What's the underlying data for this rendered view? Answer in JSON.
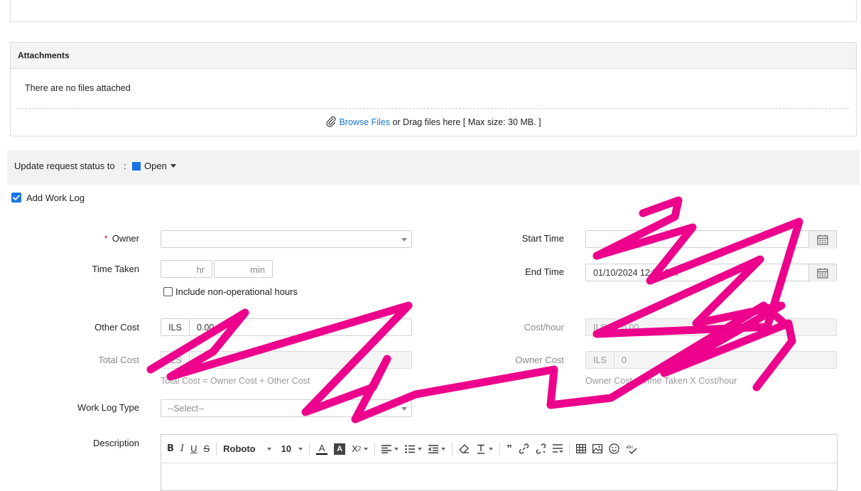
{
  "attachments": {
    "title": "Attachments",
    "empty_text": "There are no files attached",
    "browse_link": "Browse Files",
    "drag_text": " or Drag files here [ Max size: 30 MB. ]"
  },
  "status": {
    "label": "Update request status to",
    "separator": ":",
    "value": "Open",
    "color": "#1a73e8"
  },
  "worklog": {
    "checkbox_label": "Add Work Log",
    "checked": true,
    "owner_label": "Owner",
    "required_mark": "*",
    "time_taken_label": "Time Taken",
    "hr_unit": "hr",
    "min_unit": "min",
    "non_operational_label": "Include non-operational hours",
    "start_time_label": "Start Time",
    "end_time_label": "End Time",
    "end_time_value": "01/10/2024 12:54 PM",
    "other_cost_label": "Other Cost",
    "other_cost_currency": "ILS",
    "other_cost_value": "0.00",
    "cost_hour_label": "Cost/hour",
    "cost_hour_currency": "ILS",
    "cost_hour_value": "0.00",
    "total_cost_label": "Total Cost",
    "total_cost_currency": "ILS",
    "total_cost_value": "0",
    "owner_cost_label": "Owner Cost",
    "owner_cost_currency": "ILS",
    "owner_cost_value": "0",
    "total_cost_hint": "Total Cost = Owner Cost + Other Cost",
    "owner_cost_hint": "Owner Cost = Time Taken X Cost/hour",
    "worklog_type_label": "Work Log Type",
    "worklog_type_placeholder": "--Select--",
    "description_label": "Description"
  },
  "editor": {
    "font_name": "Roboto",
    "font_size": "10",
    "tools": [
      "bold",
      "italic",
      "underline",
      "strikethrough",
      "font-family",
      "font-size",
      "font-color",
      "highlight",
      "superscript",
      "align",
      "list",
      "indent",
      "clear-format",
      "text-transform",
      "quote",
      "link",
      "unlink",
      "line-spacing",
      "table",
      "image",
      "emoji",
      "spellcheck"
    ]
  },
  "annotation": {
    "color": "#ec008c"
  }
}
